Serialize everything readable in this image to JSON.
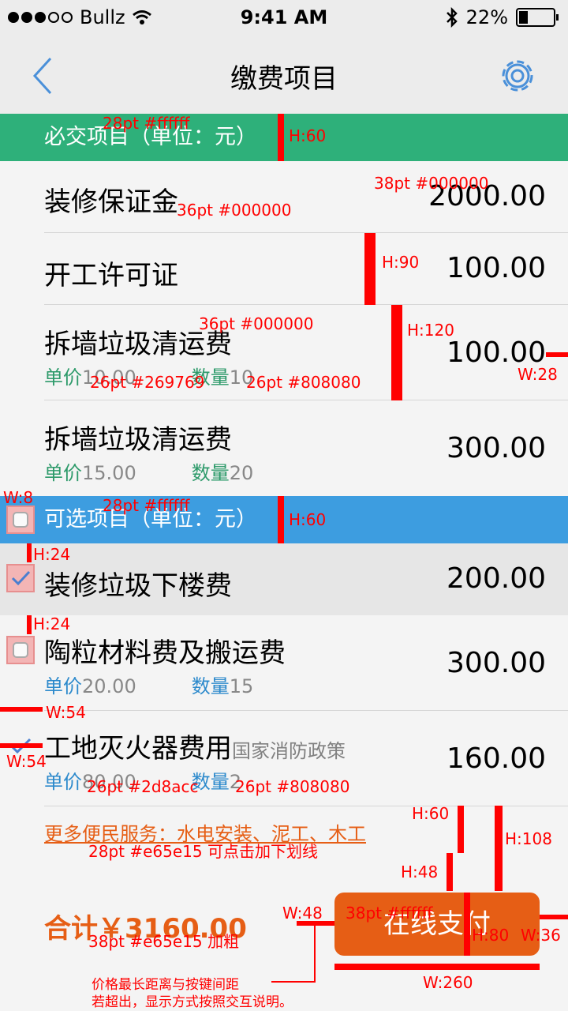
{
  "status_bar": {
    "carrier": "Bullz",
    "time": "9:41 AM",
    "battery": "22%"
  },
  "nav": {
    "title": "缴费项目"
  },
  "required_section": {
    "title": "必交项目（单位：元）"
  },
  "required_items": [
    {
      "name": "装修保证金",
      "amount": "2000.00"
    },
    {
      "name": "开工许可证",
      "amount": "100.00"
    },
    {
      "name": "拆墙垃圾清运费",
      "amount": "100.00",
      "price_label": "单价",
      "price": "10.00",
      "qty_label": "数量",
      "qty": "10"
    },
    {
      "name": "拆墙垃圾清运费",
      "amount": "300.00",
      "price_label": "单价",
      "price": "15.00",
      "qty_label": "数量",
      "qty": "20"
    }
  ],
  "optional_section": {
    "title": "可选项目（单位：元）"
  },
  "optional_items": [
    {
      "name": "装修垃圾下楼费",
      "amount": "200.00"
    },
    {
      "name": "陶粒材料费及搬运费",
      "amount": "300.00",
      "price_label": "单价",
      "price": "20.00",
      "qty_label": "数量",
      "qty": "15"
    },
    {
      "name": "工地灭火器费用",
      "note": "国家消防政策",
      "amount": "160.00",
      "price_label": "单价",
      "price": "80.00",
      "qty_label": "数量",
      "qty": "2"
    }
  ],
  "more_services": "更多便民服务：水电安装、泥工、木工",
  "total": "合计￥3160.00",
  "pay_button": "在线支付",
  "annotations": {
    "a1": "28pt #ffffff",
    "a2": "H:60",
    "a3": "38pt #000000",
    "a4": "36pt #000000",
    "a5": "H:90",
    "a6": "36pt #000000",
    "a7": "H:120",
    "a8": "W:28",
    "a9": "26pt #269769",
    "a10": "26pt #808080",
    "a11": "W:8",
    "a12": "28pt #ffffff",
    "a13": "H:60",
    "a14": "H:24",
    "a15": "H:24",
    "a16": "W:54",
    "a17": "W:54",
    "a18": "26pt #2d8acc",
    "a19": "26pt #808080",
    "a20": "H:60",
    "a21": "H:108",
    "a22": "28pt #e65e15 可点击加下划线",
    "a23": "H:48",
    "a24": "W:48",
    "a25": "38pt #ffffff",
    "a26": "H:80",
    "a27": "W:36",
    "a28": "38pt #e65e15 加粗",
    "a29": "W:260",
    "a30": "价格最长距离与按键间距",
    "a31": "若超出，显示方式按照交互说明。"
  },
  "colors": {
    "required": "#2eb07a",
    "optional": "#3d9de0",
    "accent": "#e65e15"
  }
}
